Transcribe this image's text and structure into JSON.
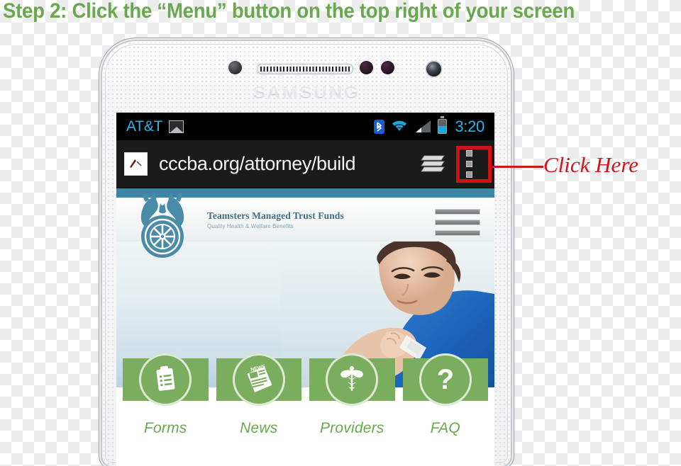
{
  "instruction": {
    "title": "Step 2: Click the “Menu” button on the top right of your screen",
    "title_color": "#6aa84f"
  },
  "annotation": {
    "label": "Click Here",
    "color": "#cc1620"
  },
  "device": {
    "brand": "SAMSUNG",
    "body_color": "#f4f5f6"
  },
  "status_bar": {
    "carrier": "AT&T",
    "time": "3:20",
    "accent_color": "#25b6e8",
    "icons": [
      "gallery-icon",
      "bluetooth-icon",
      "wifi-icon",
      "signal-icon",
      "battery-icon"
    ]
  },
  "browser": {
    "url": "cccba.org/attorney/build",
    "favicon_name": "page-favicon",
    "tabs_icon_name": "tabs-stack-icon",
    "menu_icon_name": "overflow-menu-icon",
    "highlight_color": "#d01217",
    "bar_color": "#1b1b1b"
  },
  "website": {
    "topbar_color": "#3d87a6",
    "brand_title": "Teamsters Managed Trust Funds",
    "brand_subtitle": "Quality Health & Welfare Benefits",
    "logo_name": "teamsters-horse-wheel-logo",
    "menu_icon_name": "hamburger-menu-icon",
    "accent_green": "#7aad5e",
    "hero_alt": "child-with-bandage-photo",
    "nav_tiles": [
      {
        "label": "Forms",
        "icon": "clipboard-icon"
      },
      {
        "label": "News",
        "icon": "newspaper-icon"
      },
      {
        "label": "Providers",
        "icon": "caduceus-icon"
      },
      {
        "label": "FAQ",
        "icon": "question-mark-icon"
      }
    ]
  }
}
